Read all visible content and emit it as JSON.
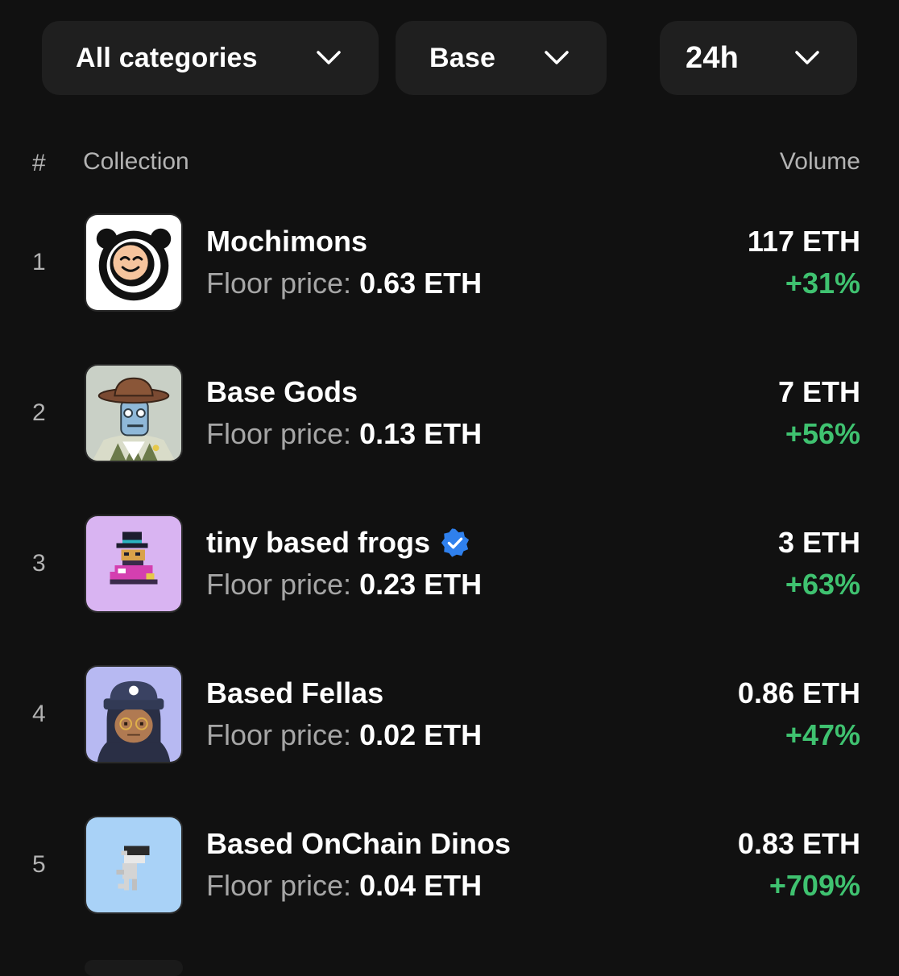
{
  "filters": {
    "category": {
      "label": "All categories",
      "icon": "chevron-down-icon"
    },
    "chain": {
      "label": "Base",
      "icon": "chevron-down-icon"
    },
    "timeframe": {
      "label": "24h",
      "icon": "chevron-down-icon"
    }
  },
  "table": {
    "headers": {
      "rank": "#",
      "collection": "Collection",
      "volume": "Volume"
    },
    "floor_label": "Floor price:",
    "rows": [
      {
        "rank": "1",
        "name": "Mochimons",
        "floor": "0.63 ETH",
        "volume": "117 ETH",
        "change": "+31%",
        "verified": false
      },
      {
        "rank": "2",
        "name": "Base Gods",
        "floor": "0.13 ETH",
        "volume": "7 ETH",
        "change": "+56%",
        "verified": false
      },
      {
        "rank": "3",
        "name": "tiny based frogs",
        "floor": "0.23 ETH",
        "volume": "3 ETH",
        "change": "+63%",
        "verified": true
      },
      {
        "rank": "4",
        "name": "Based Fellas",
        "floor": "0.02 ETH",
        "volume": "0.86 ETH",
        "change": "+47%",
        "verified": false
      },
      {
        "rank": "5",
        "name": "Based OnChain Dinos",
        "floor": "0.04 ETH",
        "volume": "0.83 ETH",
        "change": "+709%",
        "verified": false
      }
    ]
  },
  "colors": {
    "background": "#111111",
    "surface": "#1f1f1f",
    "positive": "#3fc270",
    "verified": "#2f80ed",
    "muted": "#a6a6a6"
  }
}
